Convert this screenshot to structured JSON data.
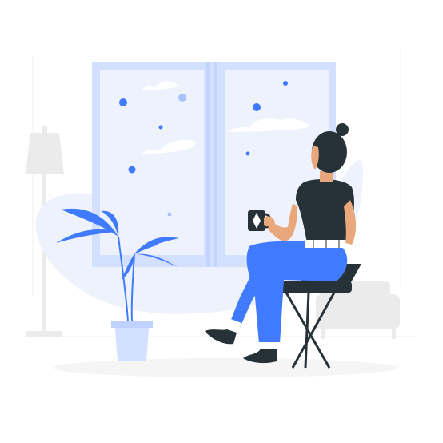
{
  "illustration": {
    "subject": "woman-sitting-by-window",
    "palette": {
      "accent": "#407BFF",
      "accent_light": "#D4E0FF",
      "accent_pale": "#EEF2FC",
      "dark": "#263238",
      "skin": "#E8A87C",
      "gray_light": "#EBEBEB",
      "gray_mid": "#DADADA",
      "white": "#FFFFFF"
    },
    "icons": [
      "snowflake-icon",
      "cloud-icon",
      "diamond-icon"
    ]
  }
}
